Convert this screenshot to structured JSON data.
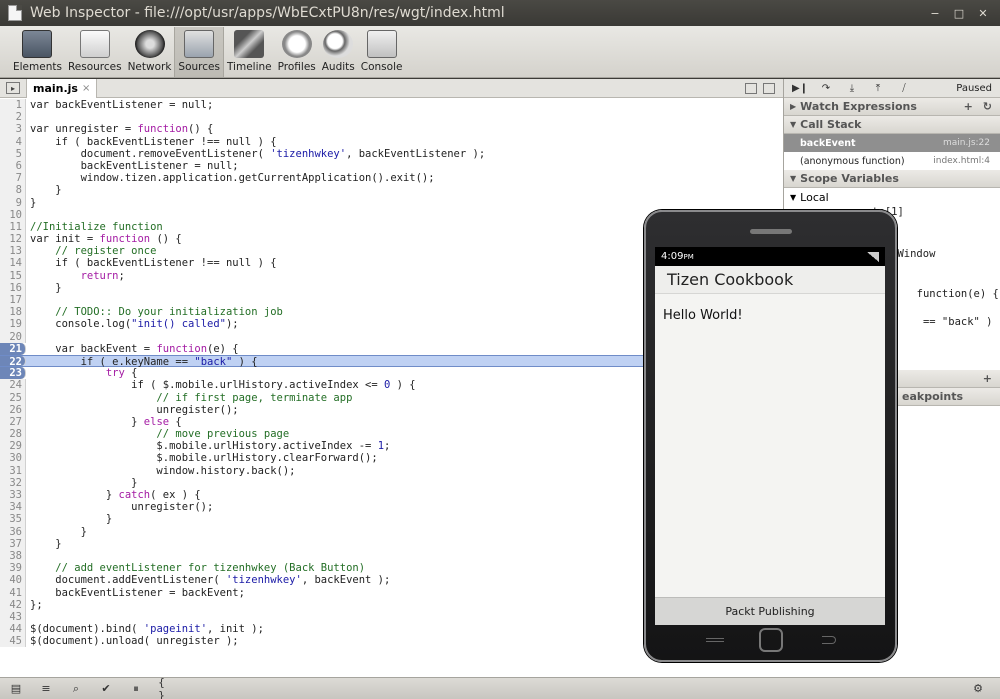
{
  "window": {
    "title": "Web Inspector - file:///opt/usr/apps/WbECxtPU8n/res/wgt/index.html",
    "controls": [
      "−",
      "□",
      "✕"
    ]
  },
  "toolbar": {
    "tools": [
      {
        "label": "Elements",
        "icon": "elements-icon"
      },
      {
        "label": "Resources",
        "icon": "resources-icon"
      },
      {
        "label": "Network",
        "icon": "network-icon"
      },
      {
        "label": "Sources",
        "icon": "sources-icon",
        "active": true
      },
      {
        "label": "Timeline",
        "icon": "timeline-icon"
      },
      {
        "label": "Profiles",
        "icon": "profiles-icon"
      },
      {
        "label": "Audits",
        "icon": "audits-icon"
      },
      {
        "label": "Console",
        "icon": "console-icon"
      }
    ]
  },
  "editor": {
    "tab_label": "main.js",
    "tab_close": "×",
    "breakpoint_lines": [
      21,
      22,
      23
    ],
    "highlight_line": 22,
    "lines": [
      "var backEventListener = null;",
      "",
      "var unregister = function() {",
      "    if ( backEventListener !== null ) {",
      "        document.removeEventListener( 'tizenhwkey', backEventListener );",
      "        backEventListener = null;",
      "        window.tizen.application.getCurrentApplication().exit();",
      "    }",
      "}",
      "",
      "//Initialize function",
      "var init = function () {",
      "    // register once",
      "    if ( backEventListener !== null ) {",
      "        return;",
      "    }",
      "",
      "    // TODO:: Do your initialization job",
      "    console.log(\"init() called\");",
      "",
      "    var backEvent = function(e) {",
      "        if ( e.keyName == \"back\" ) {",
      "            try {",
      "                if ( $.mobile.urlHistory.activeIndex <= 0 ) {",
      "                    // if first page, terminate app",
      "                    unregister();",
      "                } else {",
      "                    // move previous page",
      "                    $.mobile.urlHistory.activeIndex -= 1;",
      "                    $.mobile.urlHistory.clearForward();",
      "                    window.history.back();",
      "                }",
      "            } catch( ex ) {",
      "                unregister();",
      "            }",
      "        }",
      "    }",
      "",
      "    // add eventListener for tizenhwkey (Back Button)",
      "    document.addEventListener( 'tizenhwkey', backEvent );",
      "    backEventListener = backEvent;",
      "};",
      "",
      "$(document).bind( 'pageinit', init );",
      "$(document).unload( unregister );"
    ]
  },
  "debugger": {
    "status": "Paused",
    "buttons": [
      "▶❙",
      "↷",
      "⤓",
      "⤒",
      "⧸"
    ],
    "watch_title": "Watch Expressions",
    "watch_icons": [
      "+",
      "↻"
    ],
    "callstack_title": "Call Stack",
    "callstack": [
      {
        "name": "backEvent",
        "loc": "main.js:22",
        "selected": true
      },
      {
        "name": "(anonymous function)",
        "loc": "index.html:4",
        "selected": false
      }
    ],
    "scope_title": "Scope Variables",
    "local_label": "Local",
    "scope_lines": [
      "      arguments[1]",
      "      t",
      "      ument",
      "                 Window"
    ],
    "scope_lines_2": [
      "  function(e) {",
      "",
      "   == \"back\" ) {"
    ],
    "plus_label": "+",
    "breakpoints_fragment": "eakpoints"
  },
  "phone": {
    "time": "4:09",
    "time_suffix": "PM",
    "header": "Tizen Cookbook",
    "content": "Hello World!",
    "footer": "Packt Publishing"
  },
  "statusbar": {
    "buttons": [
      "▤",
      "≡",
      "⌕",
      "✔",
      "⏸",
      "{ }"
    ],
    "gear": "⚙"
  }
}
